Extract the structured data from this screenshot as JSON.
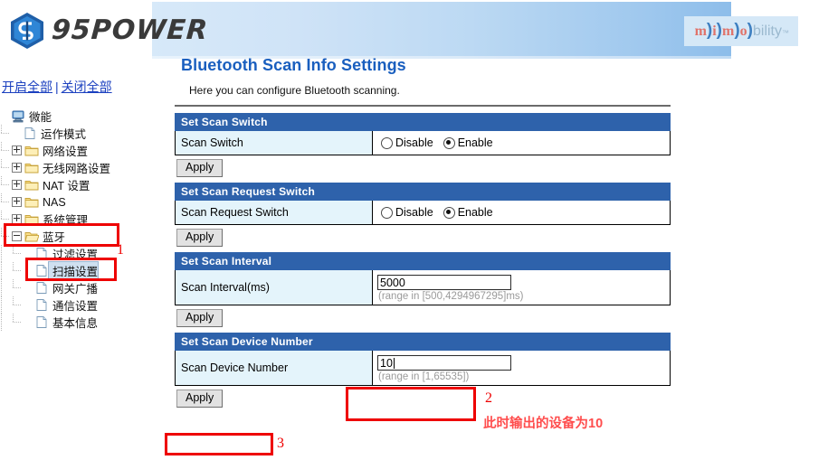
{
  "header": {
    "brand_left": "95POWER",
    "brand_left_icon": "95power-hex-logo-icon",
    "brand_right_m1": "m",
    "brand_right_p1": ")",
    "brand_right_i": "i",
    "brand_right_p2": ")",
    "brand_right_m2": "m",
    "brand_right_p3": ")",
    "brand_right_o": "o",
    "brand_right_p4": ")",
    "brand_right_tail": "bility",
    "brand_right_tm": "™"
  },
  "sidebar": {
    "expand_all": "开启全部",
    "separator": "|",
    "collapse_all": "关闭全部",
    "root": {
      "label": "微能",
      "icon": "computer-icon"
    },
    "items": [
      {
        "label": "运作模式",
        "icon": "page-icon",
        "type": "leaf",
        "level": 1,
        "expandable": false
      },
      {
        "label": "网络设置",
        "icon": "folder-icon",
        "type": "folder",
        "level": 1,
        "expandable": true
      },
      {
        "label": "无线网路设置",
        "icon": "folder-icon",
        "type": "folder",
        "level": 1,
        "expandable": true
      },
      {
        "label": "NAT 设置",
        "icon": "folder-icon",
        "type": "folder",
        "level": 1,
        "expandable": true
      },
      {
        "label": "NAS",
        "icon": "folder-icon",
        "type": "folder",
        "level": 1,
        "expandable": true
      },
      {
        "label": "系统管理",
        "icon": "folder-icon",
        "type": "folder",
        "level": 1,
        "expandable": true
      },
      {
        "label": "蓝牙",
        "icon": "folder-open-icon",
        "type": "folder",
        "level": 1,
        "expandable": true,
        "expanded": true
      },
      {
        "label": "过滤设置",
        "icon": "page-icon",
        "type": "leaf",
        "level": 2,
        "expandable": false
      },
      {
        "label": "扫描设置",
        "icon": "page-icon",
        "type": "leaf",
        "level": 2,
        "expandable": false,
        "selected": true
      },
      {
        "label": "网关广播",
        "icon": "page-icon",
        "type": "leaf",
        "level": 2,
        "expandable": false
      },
      {
        "label": "通信设置",
        "icon": "page-icon",
        "type": "leaf",
        "level": 2,
        "expandable": false
      },
      {
        "label": "基本信息",
        "icon": "page-icon",
        "type": "leaf",
        "level": 2,
        "expandable": false
      }
    ]
  },
  "main": {
    "title": "Bluetooth Scan Info Settings",
    "description": "Here you can configure Bluetooth scanning.",
    "sections": [
      {
        "heading": "Set Scan Switch",
        "label": "Scan Switch",
        "control": "radio",
        "options": [
          "Disable",
          "Enable"
        ],
        "selected": "Enable",
        "apply": "Apply"
      },
      {
        "heading": "Set Scan Request Switch",
        "label": "Scan Request Switch",
        "control": "radio",
        "options": [
          "Disable",
          "Enable"
        ],
        "selected": "Enable",
        "apply": "Apply"
      },
      {
        "heading": "Set Scan Interval",
        "label": "Scan Interval(ms)",
        "control": "text",
        "value": "5000",
        "hint": "(range in [500,4294967295]ms)",
        "apply": "Apply"
      },
      {
        "heading": "Set Scan Device Number",
        "label": "Scan Device Number",
        "control": "text",
        "value": "10",
        "hint": "(range in [1,65535])",
        "apply": "Apply"
      }
    ]
  },
  "annotations": {
    "step1": "1",
    "step2": "2",
    "step3": "3",
    "note_cn": "此时输出的设备为10",
    "accent_color": "#ee0000",
    "note_color": "#ff4d4d"
  }
}
